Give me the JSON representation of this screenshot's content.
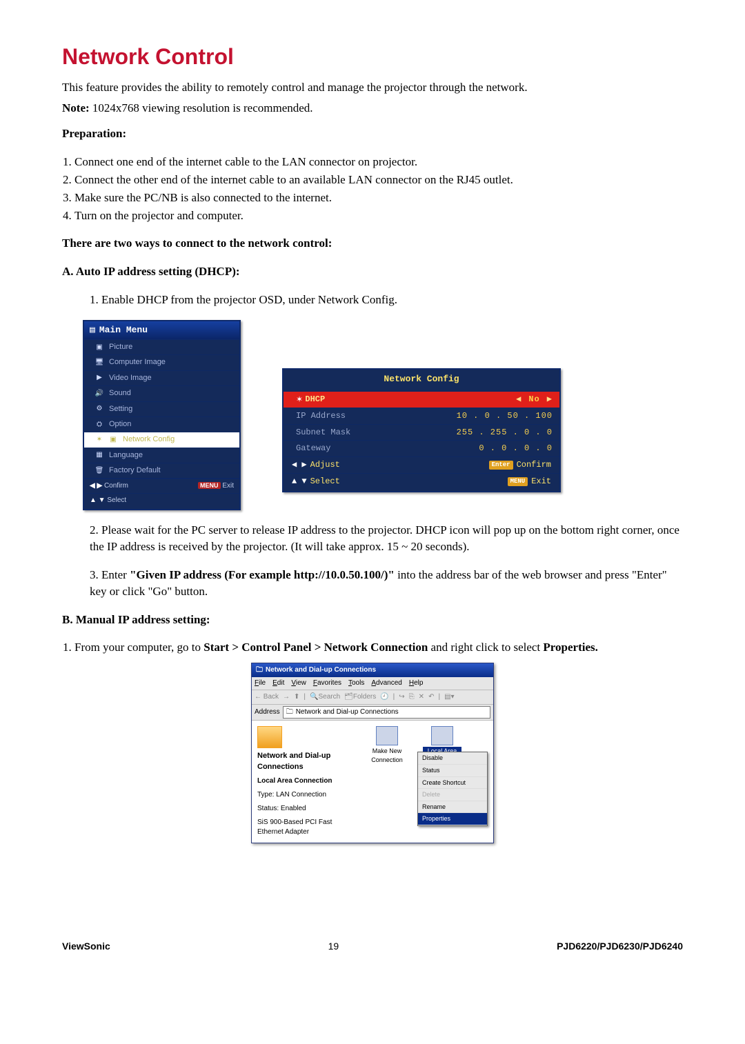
{
  "title": "Network Control",
  "intro": "This feature provides the ability to remotely control and manage the projector through the network.",
  "note_label": "Note:",
  "note_text": " 1024x768 viewing resolution is recommended.",
  "prep_heading": "Preparation:",
  "prep_steps": [
    "Connect one end of the internet cable to the LAN connector on projector.",
    "Connect the other end of the internet cable to an available LAN connector on the RJ45 outlet.",
    "Make sure the PC/NB is also connected to the internet.",
    "Turn on the projector and computer."
  ],
  "two_ways_heading": "There are two ways to connect to the network control:",
  "sectionA_heading": "A.  Auto IP address setting (DHCP):",
  "sectionA_step1": "1. Enable DHCP from the projector OSD, under Network Config.",
  "sectionA_step2": "2. Please wait for the PC server to release IP address to the projector. DHCP icon will pop up on the bottom right corner, once the IP address is received by the projector. (It will take approx. 15 ~ 20 seconds).",
  "sectionA_step3_pre": "3. Enter ",
  "sectionA_step3_bold": "\"Given IP address (For example http://10.0.50.100/)\"",
  "sectionA_step3_post": " into the address bar of the web browser and press \"Enter\" key or click \"Go\" button.",
  "sectionB_heading": "B.  Manual IP address setting:",
  "sectionB_step1_pre": "From your computer, go to ",
  "sectionB_step1_bold1": "Start > Control Panel > Network Connection",
  "sectionB_step1_mid": " and right click to select ",
  "sectionB_step1_bold2": "Properties.",
  "osd_main": {
    "title": "Main Menu",
    "items": [
      "Picture",
      "Computer Image",
      "Video Image",
      "Sound",
      "Setting",
      "Option",
      "Network Config",
      "Language",
      "Factory Default"
    ],
    "confirm": "Confirm",
    "exit": "Exit",
    "menu_label": "MENU",
    "select": "Select"
  },
  "osd_nc": {
    "title": "Network Config",
    "dhcp_label": "DHCP",
    "dhcp_value": "No",
    "rows": [
      {
        "label": "IP Address",
        "value": "10 .   0  . 50 . 100"
      },
      {
        "label": "Subnet Mask",
        "value": "255 . 255 .   0 .   0"
      },
      {
        "label": "Gateway",
        "value": "0 .   0 .   0 .   0"
      }
    ],
    "adjust": "Adjust",
    "confirm": "Confirm",
    "select": "Select",
    "exit": "Exit",
    "enter": "Enter",
    "menu_label": "MENU"
  },
  "win": {
    "title": "Network and Dial-up Connections",
    "menu": [
      "File",
      "Edit",
      "View",
      "Favorites",
      "Tools",
      "Advanced",
      "Help"
    ],
    "toolbar": {
      "back": "Back",
      "search": "Search",
      "folders": "Folders"
    },
    "address_label": "Address",
    "address_value": "Network and Dial-up Connections",
    "heading": "Network and Dial-up Connections",
    "lac_label": "Local Area Connection",
    "type_line": "Type: LAN Connection",
    "status_line": "Status: Enabled",
    "adapter_line": "SiS 900-Based PCI Fast Ethernet Adapter",
    "make_new": "Make New Connection",
    "selected_icon_label": "Local Area Connection",
    "context": [
      "Disable",
      "Status",
      "Create Shortcut",
      "Delete",
      "Rename",
      "Properties"
    ]
  },
  "footer": {
    "brand": "ViewSonic",
    "page": "19",
    "models": "PJD6220/PJD6230/PJD6240"
  }
}
